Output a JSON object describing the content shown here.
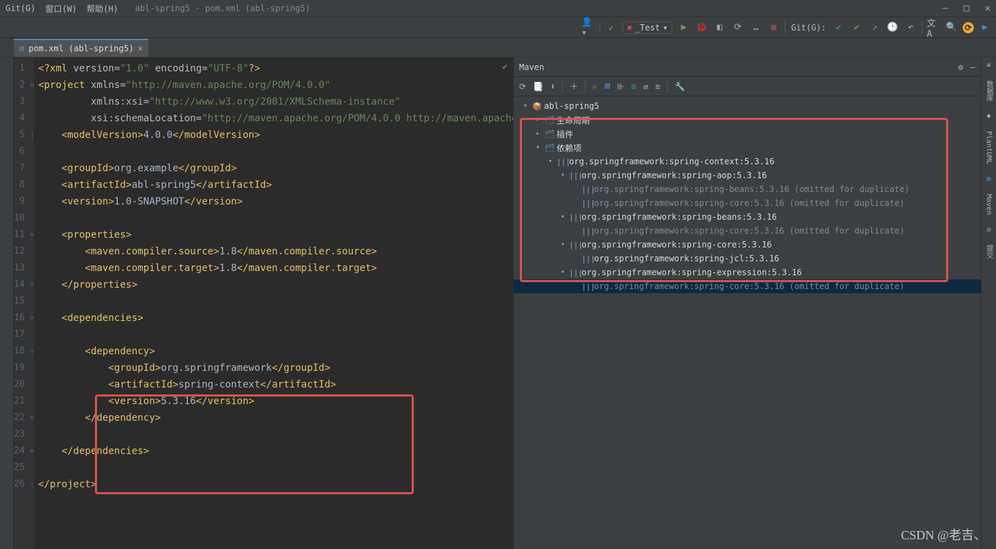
{
  "menubar": {
    "git": "Git(G)",
    "window": "窗口(W)",
    "help": "帮助(H)",
    "path": "abl-spring5 - pom.xml (abl-spring5)"
  },
  "winctrl": {
    "min": "—",
    "max": "□",
    "close": "✕"
  },
  "toolbar": {
    "runconfig": "_Test",
    "gitlabel": "Git(G):"
  },
  "tab": {
    "label": "pom.xml (abl-spring5)"
  },
  "code": {
    "lines": [
      {
        "n": "1",
        "h": "<span class='kw'>&lt;?xml</span> <span class='attr'>version</span>=<span class='str'>\"1.0\"</span> <span class='attr'>encoding</span>=<span class='str'>\"UTF-8\"</span><span class='kw'>?&gt;</span>"
      },
      {
        "n": "2",
        "h": "<span class='kw'>&lt;project</span> <span class='attr'>xmlns</span>=<span class='str'>\"http://maven.apache.org/POM/4.0.0\"</span>"
      },
      {
        "n": "3",
        "h": "         <span class='attr'>xmlns:</span><span class='txt'>xsi</span>=<span class='str'>\"http://www.w3.org/2001/XMLSchema-instance\"</span>"
      },
      {
        "n": "4",
        "h": "         <span class='txt'>xsi</span><span class='attr'>:schemaLocation</span>=<span class='str'>\"http://maven.apache.org/POM/4.0.0 http://maven.apache</span>"
      },
      {
        "n": "5",
        "h": "    <span class='kw'>&lt;modelVersion&gt;</span><span class='txt'>4.0.0</span><span class='kw'>&lt;/modelVersion&gt;</span>"
      },
      {
        "n": "6",
        "h": ""
      },
      {
        "n": "7",
        "h": "    <span class='kw'>&lt;groupId&gt;</span><span class='txt'>org.example</span><span class='kw'>&lt;/groupId&gt;</span>"
      },
      {
        "n": "8",
        "h": "    <span class='kw'>&lt;artifactId&gt;</span><span class='txt'>abl-spring5</span><span class='kw'>&lt;/artifactId&gt;</span>"
      },
      {
        "n": "9",
        "h": "    <span class='kw'>&lt;version&gt;</span><span class='txt'>1.0-SNAPSHOT</span><span class='kw'>&lt;/version&gt;</span>"
      },
      {
        "n": "10",
        "h": ""
      },
      {
        "n": "11",
        "h": "    <span class='kw'>&lt;properties&gt;</span>"
      },
      {
        "n": "12",
        "h": "        <span class='kw'>&lt;maven.compiler.source&gt;</span><span class='txt'>1.8</span><span class='kw'>&lt;/maven.compiler.source&gt;</span>"
      },
      {
        "n": "13",
        "h": "        <span class='kw'>&lt;maven.compiler.target&gt;</span><span class='txt'>1.8</span><span class='kw'>&lt;/maven.compiler.target&gt;</span>"
      },
      {
        "n": "14",
        "h": "    <span class='kw'>&lt;/properties&gt;</span>"
      },
      {
        "n": "15",
        "h": ""
      },
      {
        "n": "16",
        "h": "    <span class='kw'>&lt;dependencies&gt;</span>"
      },
      {
        "n": "17",
        "h": ""
      },
      {
        "n": "18",
        "h": "        <span class='kw'>&lt;dependency&gt;</span>"
      },
      {
        "n": "19",
        "h": "            <span class='kw'>&lt;groupId&gt;</span><span class='txt'>org.springframework</span><span class='kw'>&lt;/groupId&gt;</span>"
      },
      {
        "n": "20",
        "h": "            <span class='kw'>&lt;artifactId&gt;</span><span class='txt'>spring-context</span><span class='kw'>&lt;/artifactId&gt;</span>"
      },
      {
        "n": "21",
        "h": "            <span class='kw'>&lt;version&gt;</span><span class='txt'>5.3.16</span><span class='kw'>&lt;/version&gt;</span>"
      },
      {
        "n": "22",
        "h": "        <span class='kw'>&lt;/dependency&gt;</span>"
      },
      {
        "n": "23",
        "h": ""
      },
      {
        "n": "24",
        "h": "    <span class='kw'>&lt;/dependencies&gt;</span>"
      },
      {
        "n": "25",
        "h": ""
      },
      {
        "n": "26",
        "h": "<span class='kw'>&lt;/project&gt;</span>"
      }
    ]
  },
  "maven": {
    "title": "Maven",
    "tree": [
      {
        "d": 0,
        "a": "▾",
        "i": "📦",
        "c": "#6897bb",
        "t": "abl-spring5"
      },
      {
        "d": 1,
        "a": "▸",
        "i": "🗂",
        "c": "#6897bb",
        "t": "生命周期"
      },
      {
        "d": 1,
        "a": "▸",
        "i": "🗂",
        "c": "#6897bb",
        "t": "插件"
      },
      {
        "d": 1,
        "a": "▾",
        "i": "🗂",
        "c": "#6897bb",
        "t": "依赖项"
      },
      {
        "d": 2,
        "a": "▾",
        "i": "|||",
        "c": "#6fb0ea",
        "t": "org.springframework:spring-context:5.3.16"
      },
      {
        "d": 3,
        "a": "▾",
        "i": "|||",
        "c": "#6fb0ea",
        "t": "org.springframework:spring-aop:5.3.16"
      },
      {
        "d": 4,
        "a": "",
        "i": "|||",
        "c": "#6fb0ea",
        "t": "org.springframework:spring-beans:5.3.16 (omitted for duplicate)",
        "dim": true
      },
      {
        "d": 4,
        "a": "",
        "i": "|||",
        "c": "#6fb0ea",
        "t": "org.springframework:spring-core:5.3.16 (omitted for duplicate)",
        "dim": true
      },
      {
        "d": 3,
        "a": "▾",
        "i": "|||",
        "c": "#6fb0ea",
        "t": "org.springframework:spring-beans:5.3.16"
      },
      {
        "d": 4,
        "a": "",
        "i": "|||",
        "c": "#6fb0ea",
        "t": "org.springframework:spring-core:5.3.16 (omitted for duplicate)",
        "dim": true
      },
      {
        "d": 3,
        "a": "▾",
        "i": "|||",
        "c": "#6fb0ea",
        "t": "org.springframework:spring-core:5.3.16"
      },
      {
        "d": 4,
        "a": "",
        "i": "|||",
        "c": "#6fb0ea",
        "t": "org.springframework:spring-jcl:5.3.16"
      },
      {
        "d": 3,
        "a": "▾",
        "i": "|||",
        "c": "#6fb0ea",
        "t": "org.springframework:spring-expression:5.3.16"
      },
      {
        "d": 4,
        "a": "",
        "i": "|||",
        "c": "#6fb0ea",
        "t": "org.springframework:spring-core:5.3.16 (omitted for duplicate)",
        "dim": true,
        "sel": true
      }
    ]
  },
  "sidebar": {
    "db": "数据库",
    "plant": "PlantUML",
    "mvn": "Maven",
    "commit": "提交"
  },
  "watermark": "CSDN @老吉、"
}
